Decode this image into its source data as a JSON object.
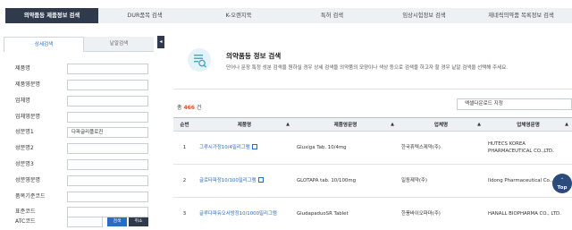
{
  "topnav": {
    "tabs": [
      {
        "label": "의약품등 제품정보 검색",
        "active": true
      },
      {
        "label": "DUR품목 검색",
        "active": false
      },
      {
        "label": "K-오렌지북",
        "active": false
      },
      {
        "label": "특허 검색",
        "active": false
      },
      {
        "label": "임상시험정보 검색",
        "active": false
      },
      {
        "label": "재네릭의약품 목록정보 검색",
        "active": false
      }
    ]
  },
  "sidebar": {
    "tabs": [
      {
        "label": "상세검색",
        "active": true
      },
      {
        "label": "낱알검색",
        "active": false
      }
    ],
    "fields": [
      {
        "label": "제품명",
        "value": ""
      },
      {
        "label": "제품영문명",
        "value": ""
      },
      {
        "label": "업체명",
        "value": ""
      },
      {
        "label": "업체영문명",
        "value": ""
      },
      {
        "label": "성분명1",
        "value": "다파글리플로진"
      },
      {
        "label": "성분명2",
        "value": ""
      },
      {
        "label": "성분명3",
        "value": ""
      },
      {
        "label": "성분영문명",
        "value": ""
      },
      {
        "label": "품목기준코드",
        "value": ""
      },
      {
        "label": "표준코드",
        "value": ""
      },
      {
        "label": "ATC코드",
        "value": ""
      }
    ],
    "atc_search_label": "검색",
    "atc_cancel_label": "취소",
    "collapse_icon": "chevron-left-icon"
  },
  "main": {
    "info": {
      "title": "의약품등 정보 검색",
      "description": "단어나 문장 특정 성분 검색을 원하실 경우 상세 검색을 의약품의 모양이나 색상 등으로 검색을 하고자 할 경우 낱알 검색을 선택해 주세요."
    },
    "count_prefix": "총",
    "count_value": "466",
    "count_suffix": "건",
    "excel_label": "엑셀다운로드 지정",
    "table": {
      "headers": [
        "순번",
        "제품명",
        "제품영문명",
        "업체명",
        "업체영문명"
      ],
      "rows": [
        [
          "1",
          "그루시가정10/4밀리그램",
          "Gluxiga Tab. 10/4mg",
          "한국휴텍스제약(주)",
          "HUTECS KOREA PHARMACEUTICAL CO.,LTD."
        ],
        [
          "2",
          "글로타파정10/100밀리그램",
          "GLOTAPA tab. 10/100mg",
          "일동제약(주)",
          "Ildong Pharmaceutical Co., Ltd."
        ],
        [
          "3",
          "글루다파듀오서방정10/1000밀리그램",
          "GludapaduoSR Tablet",
          "한풍바이오파마(주)",
          "HANALL BIOPHARMA CO., LTD."
        ]
      ]
    },
    "top_button_label": "Top",
    "top_button_icon": "chevron-up-icon"
  }
}
